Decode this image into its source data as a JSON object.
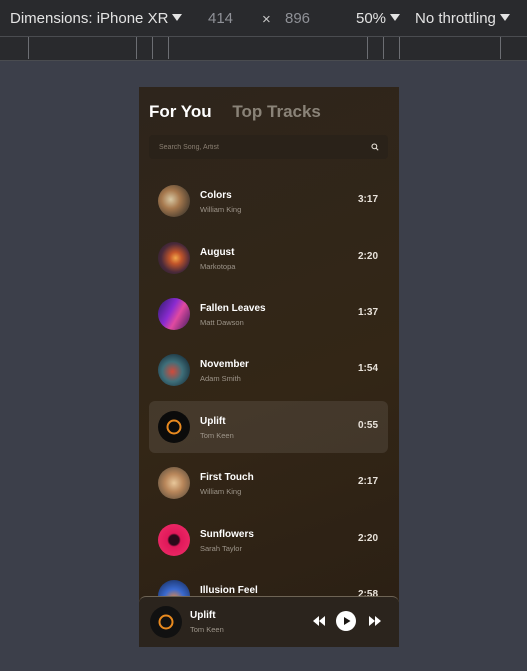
{
  "devtools": {
    "device_label": "Dimensions: iPhone XR",
    "width": "414",
    "times": "×",
    "height": "896",
    "zoom": "50%",
    "throttle": "No throttling"
  },
  "app": {
    "tabs": [
      {
        "label": "For You",
        "active": true
      },
      {
        "label": "Top Tracks",
        "active": false
      }
    ],
    "search": {
      "placeholder": "Search Song, Artist",
      "value": ""
    },
    "tracks": [
      {
        "title": "Colors",
        "artist": "William King",
        "duration": "3:17",
        "art": "painting-cover"
      },
      {
        "title": "August",
        "artist": "Markotopa",
        "duration": "2:20",
        "art": "fire-cover"
      },
      {
        "title": "Fallen Leaves",
        "artist": "Matt Dawson",
        "duration": "1:37",
        "art": "purple-cover"
      },
      {
        "title": "November",
        "artist": "Adam Smith",
        "duration": "1:54",
        "art": "teal-red-cover"
      },
      {
        "title": "Uplift",
        "artist": "Tom Keen",
        "duration": "0:55",
        "art": "ring-cover",
        "active": true
      },
      {
        "title": "First Touch",
        "artist": "William King",
        "duration": "2:17",
        "art": "sepia-cover"
      },
      {
        "title": "Sunflowers",
        "artist": "Sarah Taylor",
        "duration": "2:20",
        "art": "pink-cover"
      },
      {
        "title": "Illusion Feel",
        "artist": "",
        "duration": "2:58",
        "art": "blue-orange-cover"
      }
    ],
    "player": {
      "title": "Uplift",
      "artist": "Tom Keen",
      "controls": [
        "rewind-icon",
        "play-icon",
        "fast-forward-icon"
      ]
    }
  }
}
